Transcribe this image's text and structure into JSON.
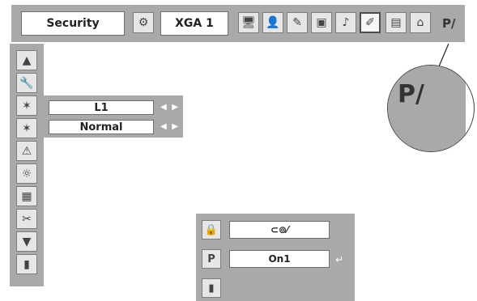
{
  "top_bar": {
    "security_label": "Security",
    "signal_label": "XGA 1",
    "icons": [
      "setup-icon",
      "monitor-icon",
      "people-icon",
      "edit-icon",
      "image-icon",
      "speaker-icon",
      "security-icon",
      "screen-icon",
      "network-icon"
    ],
    "pin_label": "P/"
  },
  "left_menu": {
    "icons": [
      "up-arrow-icon",
      "wrench-icon",
      "fan-icon",
      "fan-icon",
      "warning-icon",
      "lamp-icon",
      "filter-icon",
      "screw-icon",
      "down-arrow-icon",
      "exit-icon"
    ]
  },
  "submenu": {
    "rows": [
      {
        "value": "L1"
      },
      {
        "value": "Normal"
      }
    ]
  },
  "panel": {
    "rows": [
      {
        "icon": "lock-icon",
        "value": "⊂⊚⁄"
      },
      {
        "icon": "pin-code-lock-icon",
        "value": "On1"
      },
      {
        "icon": "exit-icon",
        "value": ""
      }
    ],
    "enter_glyph": "↵"
  },
  "zoom": {
    "label": "P/"
  }
}
